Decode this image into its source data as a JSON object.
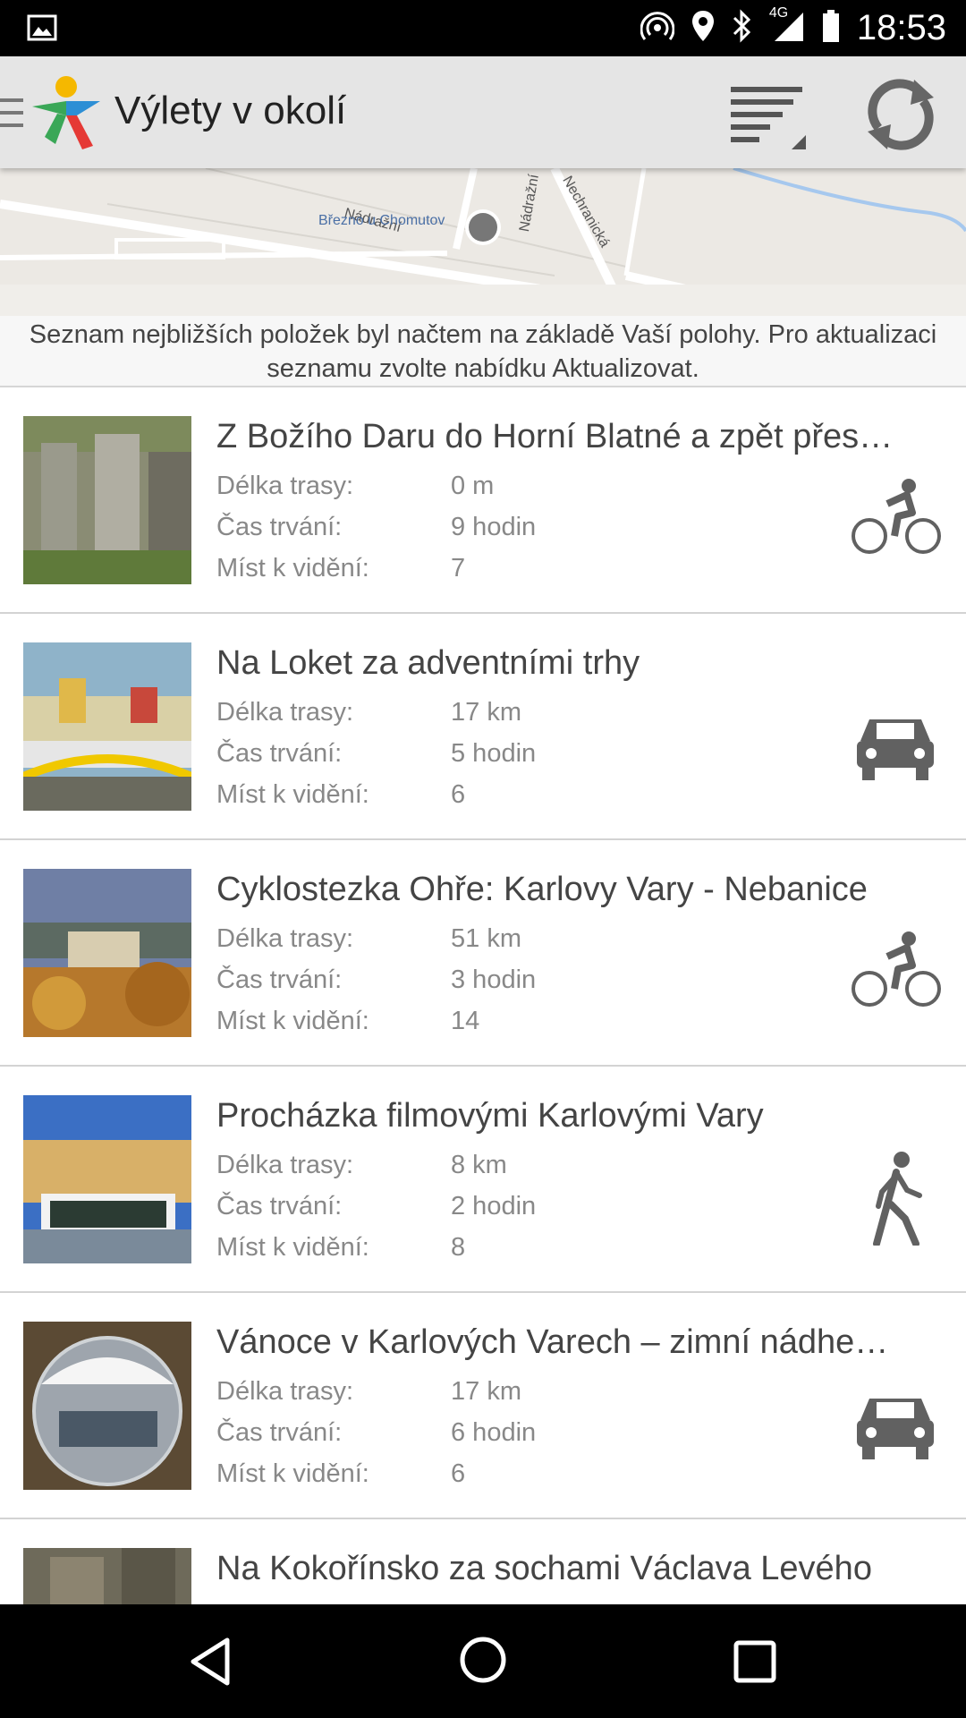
{
  "status_bar": {
    "time": "18:53",
    "network": "4G",
    "icons": [
      "image-icon",
      "hotspot-icon",
      "location-icon",
      "bluetooth-icon",
      "signal-icon",
      "battery-icon"
    ]
  },
  "app_bar": {
    "title": "Výlety v okolí",
    "icons": [
      "drawer-icon",
      "app-logo",
      "sort-icon",
      "refresh-icon"
    ]
  },
  "map": {
    "labels": [
      "Nádražní",
      "Nádražní",
      "Nechranická",
      "Březno u Chomutov"
    ]
  },
  "info": {
    "text": "Seznam nejbližších položek byl načtem na základě Vaší polohy. Pro aktualizaci seznamu zvolte nabídku Aktualizovat."
  },
  "labels": {
    "length": "Délka trasy:",
    "duration": "Čas trvání:",
    "places": "Míst k vidění:"
  },
  "trips": [
    {
      "title": "Z Božího Daru do Horní Blatné a zpět přes…",
      "length": "0 m",
      "duration": "9 hodin",
      "places": "7",
      "mode": "bicycle-icon"
    },
    {
      "title": "Na Loket za adventními trhy",
      "length": "17 km",
      "duration": "5 hodin",
      "places": "6",
      "mode": "car-icon"
    },
    {
      "title": "Cyklostezka Ohře: Karlovy Vary - Nebanice",
      "length": "51 km",
      "duration": "3 hodin",
      "places": "14",
      "mode": "bicycle-icon"
    },
    {
      "title": "Procházka filmovými Karlovými Vary",
      "length": "8 km",
      "duration": "2 hodin",
      "places": "8",
      "mode": "walk-icon"
    },
    {
      "title": "Vánoce v Karlových Varech – zimní nádhe…",
      "length": "17 km",
      "duration": "6 hodin",
      "places": "6",
      "mode": "car-icon"
    },
    {
      "title": "Na Kokořínsko za sochami Václava Levého"
    }
  ],
  "colors": {
    "status_bar": "#000000",
    "app_bar": "#e5e5e5",
    "icon_gray": "#616161"
  }
}
